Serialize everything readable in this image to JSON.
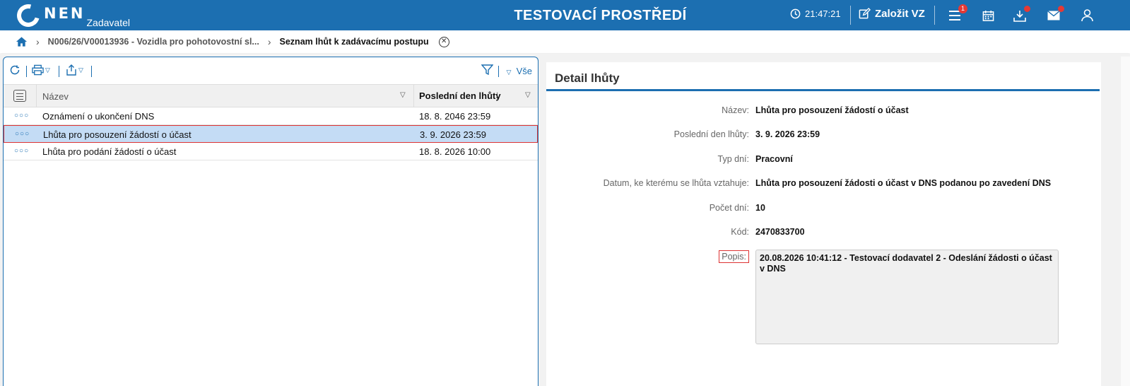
{
  "header": {
    "logo_text": "NEN",
    "logo_sub": "Zadavatel",
    "env_title": "TESTOVACÍ PROSTŘEDÍ",
    "time": "21:47:21",
    "create_label": "Založit VZ",
    "menu_badge": "1",
    "icons": [
      "clock-icon",
      "edit-icon",
      "menu-icon",
      "calendar-icon",
      "download-icon",
      "mail-icon",
      "user-icon"
    ]
  },
  "breadcrumb": {
    "item1": "N006/26/V00013936 - Vozidla pro pohotovostní sl...",
    "current": "Seznam lhůt k zadávacímu postupu"
  },
  "toolbar": {
    "filter_label": "Vše"
  },
  "grid": {
    "col_name": "Název",
    "col_date": "Poslední den lhůty",
    "rows": [
      {
        "name": "Oznámení o ukončení DNS",
        "date": "18. 8. 2046 23:59",
        "selected": false
      },
      {
        "name": "Lhůta pro posouzení žádostí o účast",
        "date": "3. 9. 2026 23:59",
        "selected": true
      },
      {
        "name": "Lhůta pro podání žádostí o účast",
        "date": "18. 8. 2026 10:00",
        "selected": false
      }
    ]
  },
  "detail": {
    "title": "Detail lhůty",
    "fields": [
      {
        "label": "Název:",
        "value": "Lhůta pro posouzení žádostí o účast"
      },
      {
        "label": "Poslední den lhůty:",
        "value": "3. 9. 2026 23:59"
      },
      {
        "label": "Typ dní:",
        "value": "Pracovní"
      },
      {
        "label": "Datum, ke kterému se lhůta vztahuje:",
        "value": "Lhůta pro posouzení žádosti o účast v DNS podanou po zavedení DNS"
      },
      {
        "label": "Počet dní:",
        "value": "10"
      },
      {
        "label": "Kód:",
        "value": "2470833700"
      }
    ],
    "popis_label": "Popis:",
    "popis_value": "20.08.2026 10:41:12 - Testovací dodavatel 2 - Odeslání žádosti o účast v DNS"
  },
  "colors": {
    "brand": "#1c6fb1",
    "selected_row": "#c4dcf5",
    "highlight_border": "#dd3333",
    "badge": "#e53935"
  }
}
